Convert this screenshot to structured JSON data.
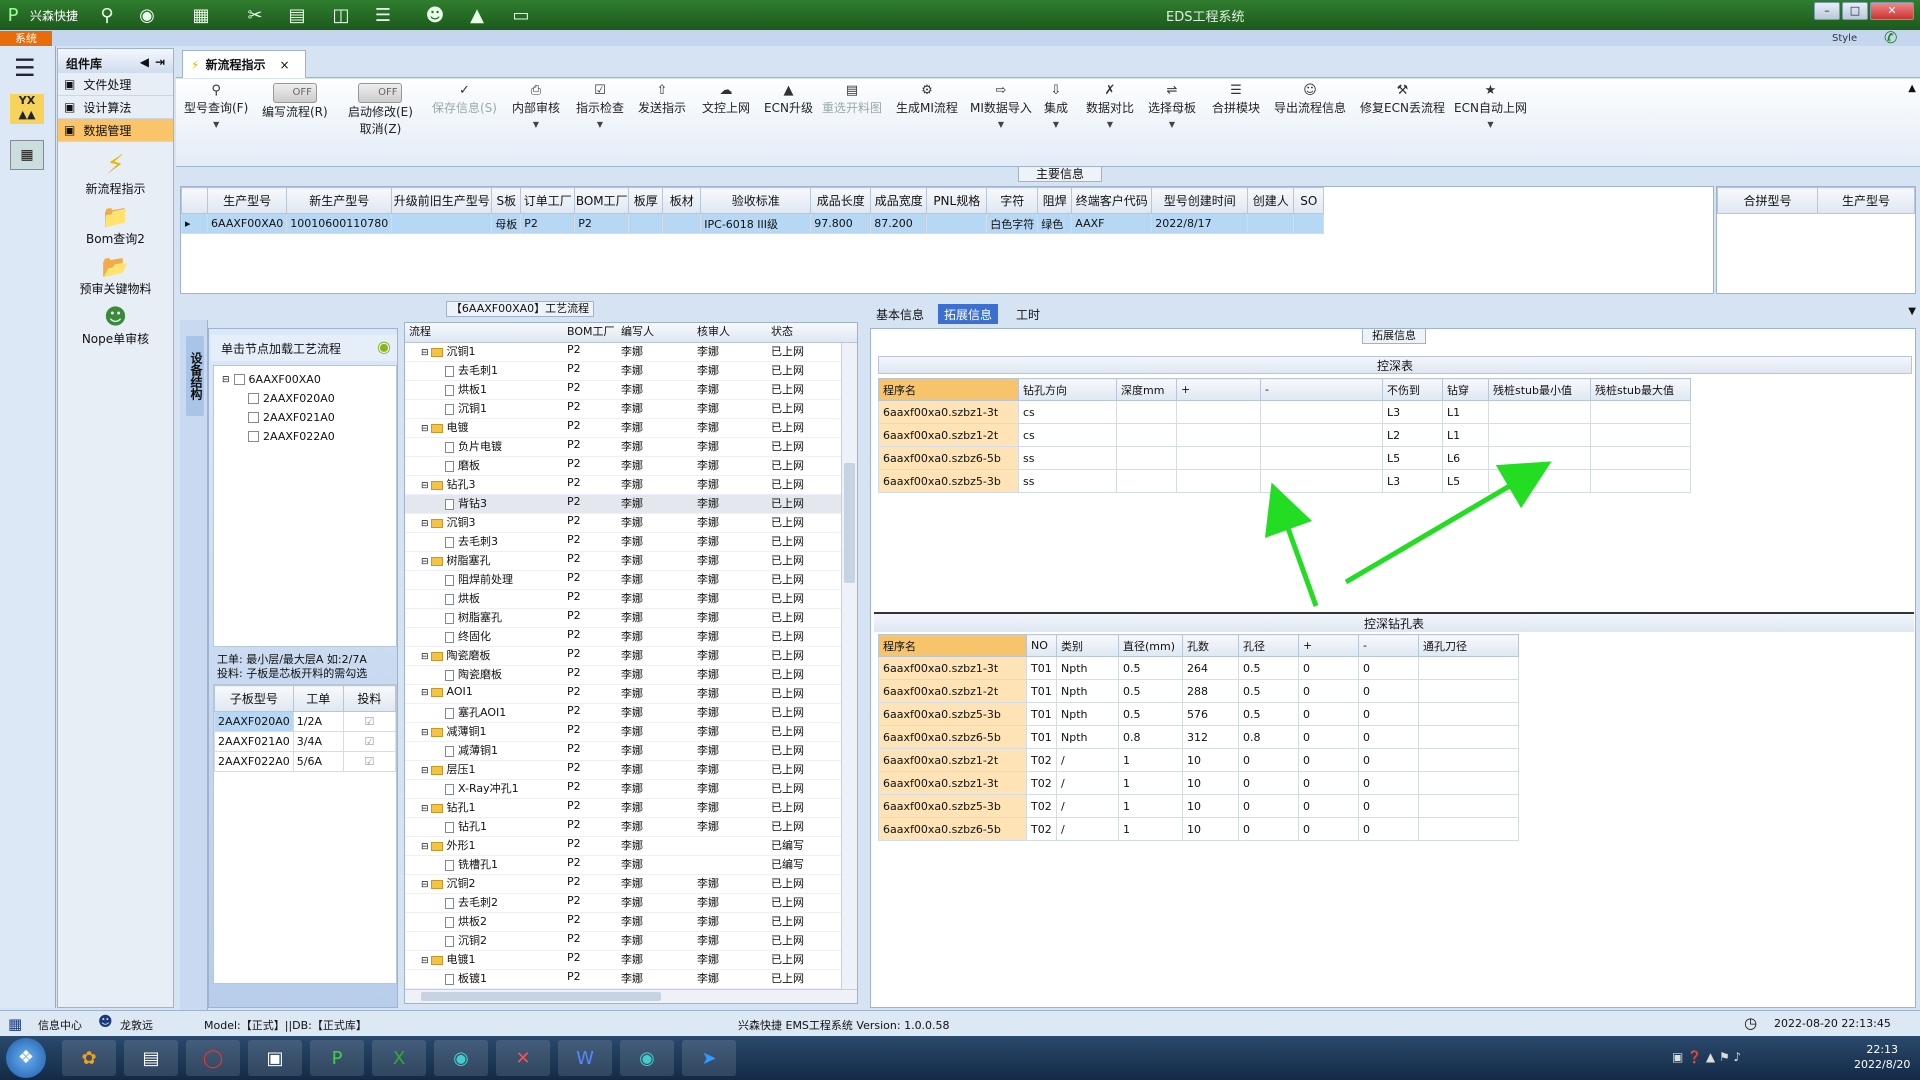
{
  "titlebar": {
    "app_name": "兴森快捷",
    "window_title": "EDS工程系统",
    "style_label": "Style"
  },
  "sysbar": {
    "tab": "系统"
  },
  "component_panel": {
    "title": "组件库",
    "items": [
      {
        "label": "文件处理"
      },
      {
        "label": "设计算法"
      },
      {
        "label": "数据管理"
      }
    ],
    "big_items": [
      {
        "label": "新流程指示"
      },
      {
        "label": "Bom查询2"
      },
      {
        "label": "预审关键物料"
      },
      {
        "label": "Nope单审核"
      }
    ]
  },
  "doc_tab": {
    "label": "新流程指示",
    "close": "×"
  },
  "toolbar": {
    "items": [
      {
        "label": "型号查询(F)",
        "icon": "search-icon"
      },
      {
        "label": "编写流程(R)",
        "toggle": "OFF"
      },
      {
        "label": "启动修改(E)",
        "label2": "取消(Z)",
        "toggle": "OFF"
      },
      {
        "label": "保存信息(S)",
        "icon": "check-icon"
      },
      {
        "label": "内部审核",
        "icon": "print-icon"
      },
      {
        "label": "指示检查",
        "icon": "check-icon"
      },
      {
        "label": "发送指示",
        "icon": "upload-icon"
      },
      {
        "label": "文控上网",
        "icon": "cloud-icon"
      },
      {
        "label": "ECN升级",
        "icon": "up-icon"
      },
      {
        "label": "重选开料图",
        "icon": "image-icon"
      },
      {
        "label": "生成MI流程",
        "icon": "gear-icon"
      },
      {
        "label": "MI数据导入",
        "icon": "import-icon"
      },
      {
        "label": "集成",
        "icon": "download-icon"
      },
      {
        "label": "数据对比",
        "icon": "compare-icon"
      },
      {
        "label": "选择母板",
        "icon": "shuffle-icon"
      },
      {
        "label": "合拼模块",
        "icon": "list-icon"
      },
      {
        "label": "导出流程信息",
        "icon": "smile-icon"
      },
      {
        "label": "修复ECN丢流程",
        "icon": "wrench-icon"
      },
      {
        "label": "ECN自动上网",
        "icon": "star-icon"
      }
    ]
  },
  "main_info": {
    "label": "主要信息",
    "columns": [
      "生产型号",
      "新生产型号",
      "升级前旧生产型号",
      "S板",
      "订单工厂",
      "BOM工厂",
      "板厚",
      "板材",
      "验收标准",
      "成品长度",
      "成品宽度",
      "PNL规格",
      "字符",
      "阻焊",
      "终端客户代码",
      "型号创建时间",
      "创建人",
      "SO"
    ],
    "row": [
      "6AAXF00XA0",
      "10010600110780",
      "",
      "母板",
      "P2",
      "P2",
      "",
      "",
      "IPC-6018 III级",
      "97.800",
      "87.200",
      "",
      "白色字符",
      "绿色",
      "AAXF",
      "2022/8/17",
      "",
      ""
    ],
    "right_columns": [
      "合拼型号",
      "生产型号"
    ]
  },
  "flow": {
    "label": "【6AAXF00XA0】工艺流程",
    "side_label": "设备结构",
    "tree_header": "单击节点加载工艺流程",
    "tree": [
      {
        "label": "6AAXF00XA0"
      },
      {
        "label": "2AAXF020A0"
      },
      {
        "label": "2AAXF021A0"
      },
      {
        "label": "2AAXF022A0"
      }
    ],
    "note_line1": "工单: 最小层/最大层A 如:2/7A",
    "note_line2": "投料: 子板是芯板开料的需勾选",
    "board_columns": [
      "子板型号",
      "工单",
      "投料"
    ],
    "boards": [
      {
        "model": "2AAXF020A0",
        "work": "1/2A"
      },
      {
        "model": "2AAXF021A0",
        "work": "3/4A"
      },
      {
        "model": "2AAXF022A0",
        "work": "5/6A"
      }
    ],
    "columns": [
      "流程",
      "BOM工厂",
      "编写人",
      "核审人",
      "状态"
    ],
    "rows": [
      {
        "name": "沉铜1",
        "type": "folder",
        "f": "P2",
        "w": "李娜",
        "r": "李娜",
        "s": "已上网"
      },
      {
        "name": "去毛刺1",
        "type": "file",
        "f": "P2",
        "w": "李娜",
        "r": "李娜",
        "s": "已上网"
      },
      {
        "name": "烘板1",
        "type": "file",
        "f": "P2",
        "w": "李娜",
        "r": "李娜",
        "s": "已上网"
      },
      {
        "name": "沉铜1",
        "type": "file",
        "f": "P2",
        "w": "李娜",
        "r": "李娜",
        "s": "已上网"
      },
      {
        "name": "电镀",
        "type": "folder",
        "f": "P2",
        "w": "李娜",
        "r": "李娜",
        "s": "已上网"
      },
      {
        "name": "负片电镀",
        "type": "file",
        "f": "P2",
        "w": "李娜",
        "r": "李娜",
        "s": "已上网"
      },
      {
        "name": "磨板",
        "type": "file",
        "f": "P2",
        "w": "李娜",
        "r": "李娜",
        "s": "已上网"
      },
      {
        "name": "钻孔3",
        "type": "folder",
        "f": "P2",
        "w": "李娜",
        "r": "李娜",
        "s": "已上网"
      },
      {
        "name": "背钻3",
        "type": "file",
        "f": "P2",
        "w": "李娜",
        "r": "李娜",
        "s": "已上网"
      },
      {
        "name": "沉铜3",
        "type": "folder",
        "f": "P2",
        "w": "李娜",
        "r": "李娜",
        "s": "已上网"
      },
      {
        "name": "去毛刺3",
        "type": "file",
        "f": "P2",
        "w": "李娜",
        "r": "李娜",
        "s": "已上网"
      },
      {
        "name": "树脂塞孔",
        "type": "folder",
        "f": "P2",
        "w": "李娜",
        "r": "李娜",
        "s": "已上网"
      },
      {
        "name": "阻焊前处理",
        "type": "file",
        "f": "P2",
        "w": "李娜",
        "r": "李娜",
        "s": "已上网"
      },
      {
        "name": "烘板",
        "type": "file",
        "f": "P2",
        "w": "李娜",
        "r": "李娜",
        "s": "已上网"
      },
      {
        "name": "树脂塞孔",
        "type": "file",
        "f": "P2",
        "w": "李娜",
        "r": "李娜",
        "s": "已上网"
      },
      {
        "name": "终固化",
        "type": "file",
        "f": "P2",
        "w": "李娜",
        "r": "李娜",
        "s": "已上网"
      },
      {
        "name": "陶瓷磨板",
        "type": "folder",
        "f": "P2",
        "w": "李娜",
        "r": "李娜",
        "s": "已上网"
      },
      {
        "name": "陶瓷磨板",
        "type": "file",
        "f": "P2",
        "w": "李娜",
        "r": "李娜",
        "s": "已上网"
      },
      {
        "name": "AOI1",
        "type": "folder",
        "f": "P2",
        "w": "李娜",
        "r": "李娜",
        "s": "已上网"
      },
      {
        "name": "塞孔AOI1",
        "type": "file",
        "f": "P2",
        "w": "李娜",
        "r": "李娜",
        "s": "已上网"
      },
      {
        "name": "减薄铜1",
        "type": "folder",
        "f": "P2",
        "w": "李娜",
        "r": "李娜",
        "s": "已上网"
      },
      {
        "name": "减薄铜1",
        "type": "file",
        "f": "P2",
        "w": "李娜",
        "r": "李娜",
        "s": "已上网"
      },
      {
        "name": "层压1",
        "type": "folder",
        "f": "P2",
        "w": "李娜",
        "r": "李娜",
        "s": "已上网"
      },
      {
        "name": "X-Ray冲孔1",
        "type": "file",
        "f": "P2",
        "w": "李娜",
        "r": "李娜",
        "s": "已上网"
      },
      {
        "name": "钻孔1",
        "type": "folder",
        "f": "P2",
        "w": "李娜",
        "r": "李娜",
        "s": "已上网"
      },
      {
        "name": "钻孔1",
        "type": "file",
        "f": "P2",
        "w": "李娜",
        "r": "李娜",
        "s": "已上网"
      },
      {
        "name": "外形1",
        "type": "folder",
        "f": "P2",
        "w": "李娜",
        "r": "",
        "s": "已编写"
      },
      {
        "name": "铣槽孔1",
        "type": "file",
        "f": "P2",
        "w": "李娜",
        "r": "",
        "s": "已编写"
      },
      {
        "name": "沉铜2",
        "type": "folder",
        "f": "P2",
        "w": "李娜",
        "r": "李娜",
        "s": "已上网"
      },
      {
        "name": "去毛刺2",
        "type": "file",
        "f": "P2",
        "w": "李娜",
        "r": "李娜",
        "s": "已上网"
      },
      {
        "name": "烘板2",
        "type": "file",
        "f": "P2",
        "w": "李娜",
        "r": "李娜",
        "s": "已上网"
      },
      {
        "name": "沉铜2",
        "type": "file",
        "f": "P2",
        "w": "李娜",
        "r": "李娜",
        "s": "已上网"
      },
      {
        "name": "电镀1",
        "type": "folder",
        "f": "P2",
        "w": "李娜",
        "r": "李娜",
        "s": "已上网"
      },
      {
        "name": "板镀1",
        "type": "file",
        "f": "P2",
        "w": "李娜",
        "r": "李娜",
        "s": "已上网"
      }
    ]
  },
  "right_panel": {
    "tabs": [
      "基本信息",
      "拓展信息",
      "工时"
    ],
    "label": "拓展信息",
    "depth_title": "控深表",
    "depth_columns": [
      "程序名",
      "钻孔方向",
      "深度mm",
      "+",
      "-",
      "不伤到",
      "钻穿",
      "残桩stub最小值",
      "残桩stub最大值"
    ],
    "depth_rows": [
      [
        "6aaxf00xa0.szbz1-3t",
        "cs",
        "",
        "",
        "",
        "L3",
        "L1",
        "",
        ""
      ],
      [
        "6aaxf00xa0.szbz1-2t",
        "cs",
        "",
        "",
        "",
        "L2",
        "L1",
        "",
        ""
      ],
      [
        "6aaxf00xa0.szbz6-5b",
        "ss",
        "",
        "",
        "",
        "L5",
        "L6",
        "",
        ""
      ],
      [
        "6aaxf00xa0.szbz5-3b",
        "ss",
        "",
        "",
        "",
        "L3",
        "L5",
        "",
        ""
      ]
    ],
    "drill_title": "控深钻孔表",
    "drill_columns": [
      "程序名",
      "NO",
      "类别",
      "直径(mm)",
      "孔数",
      "孔径",
      "+",
      "-",
      "通孔刀径"
    ],
    "drill_rows": [
      [
        "6aaxf00xa0.szbz1-3t",
        "T01",
        "Npth",
        "0.5",
        "264",
        "0.5",
        "0",
        "0",
        ""
      ],
      [
        "6aaxf00xa0.szbz1-2t",
        "T01",
        "Npth",
        "0.5",
        "288",
        "0.5",
        "0",
        "0",
        ""
      ],
      [
        "6aaxf00xa0.szbz5-3b",
        "T01",
        "Npth",
        "0.5",
        "576",
        "0.5",
        "0",
        "0",
        ""
      ],
      [
        "6aaxf00xa0.szbz6-5b",
        "T01",
        "Npth",
        "0.8",
        "312",
        "0.8",
        "0",
        "0",
        ""
      ],
      [
        "6aaxf00xa0.szbz1-2t",
        "T02",
        "/",
        "1",
        "10",
        "0",
        "0",
        "0",
        ""
      ],
      [
        "6aaxf00xa0.szbz1-3t",
        "T02",
        "/",
        "1",
        "10",
        "0",
        "0",
        "0",
        ""
      ],
      [
        "6aaxf00xa0.szbz5-3b",
        "T02",
        "/",
        "1",
        "10",
        "0",
        "0",
        "0",
        ""
      ],
      [
        "6aaxf00xa0.szbz6-5b",
        "T02",
        "/",
        "1",
        "10",
        "0",
        "0",
        "0",
        ""
      ]
    ]
  },
  "statusbar": {
    "info_center": "信息中心",
    "user": "龙敦远",
    "model": "Model:【正式】||DB:【正式库】",
    "version": "兴森快捷 EMS工程系统 Version: 1.0.0.58",
    "datetime": "2022-08-20 22:13:45"
  },
  "taskbar": {
    "time": "22:13",
    "date": "2022/8/20"
  },
  "colors": {
    "selected_row": "#b7d8f5",
    "accent_orange": "#f7c46c",
    "arrow_green": "#22dd22",
    "titlebar_green": "#2f7d2f"
  }
}
